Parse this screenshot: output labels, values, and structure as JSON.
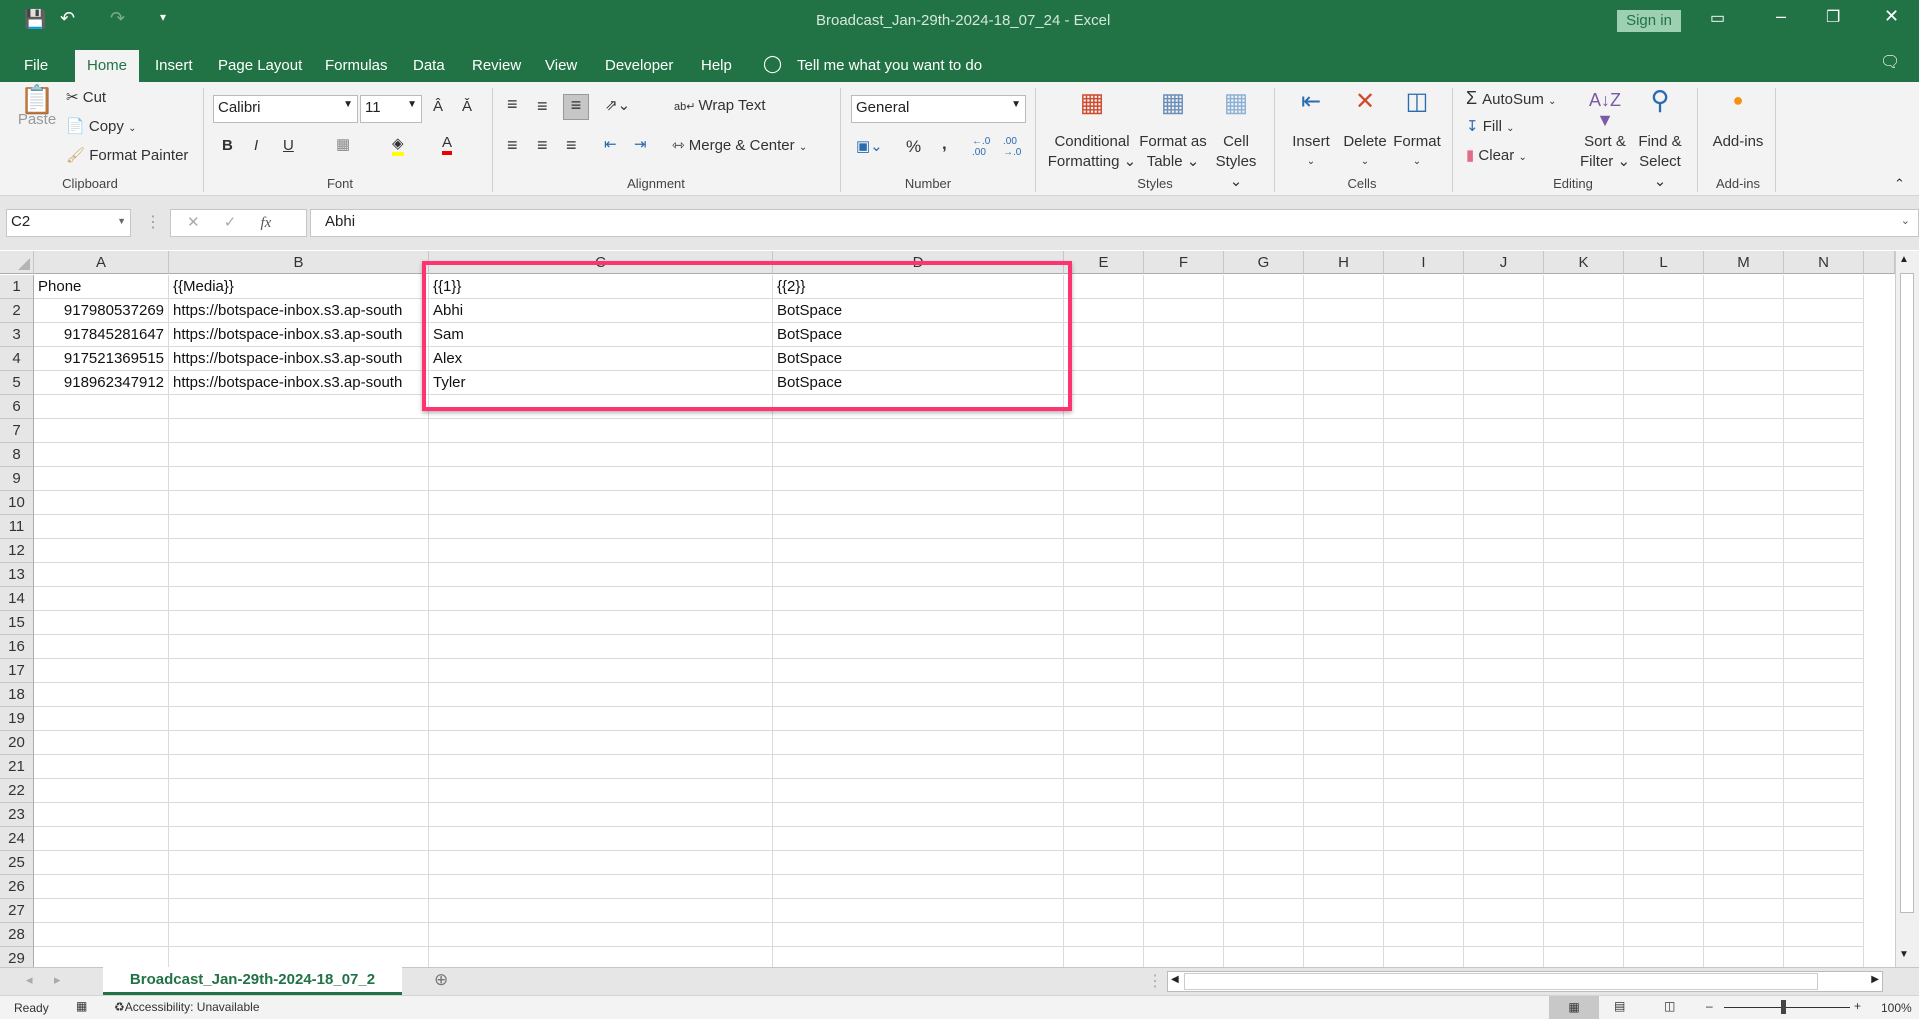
{
  "title": "Broadcast_Jan-29th-2024-18_07_24  -  Excel",
  "sign_in": "Sign in",
  "tabs": [
    "File",
    "Home",
    "Insert",
    "Page Layout",
    "Formulas",
    "Data",
    "Review",
    "View",
    "Developer",
    "Help"
  ],
  "tell_me": "Tell me what you want to do",
  "ribbon": {
    "clipboard": {
      "paste": "Paste",
      "cut": "Cut",
      "copy": "Copy",
      "format_painter": "Format Painter",
      "label": "Clipboard"
    },
    "font": {
      "name": "Calibri",
      "size": "11",
      "bold": "B",
      "italic": "I",
      "underline": "U",
      "label": "Font"
    },
    "alignment": {
      "wrap": "Wrap Text",
      "merge": "Merge & Center",
      "label": "Alignment"
    },
    "number": {
      "format": "General",
      "percent": "%",
      "comma": ",",
      "label": "Number"
    },
    "styles": {
      "conditional": [
        "Conditional",
        "Formatting"
      ],
      "format_table": [
        "Format as",
        "Table"
      ],
      "cell_styles": [
        "Cell",
        "Styles"
      ],
      "label": "Styles"
    },
    "cells": {
      "insert": "Insert",
      "delete": "Delete",
      "format": "Format",
      "label": "Cells"
    },
    "editing": {
      "autosum": "AutoSum",
      "fill": "Fill",
      "clear": "Clear",
      "sort": [
        "Sort &",
        "Filter"
      ],
      "find": [
        "Find &",
        "Select"
      ],
      "label": "Editing"
    },
    "addins": {
      "button": "Add-ins",
      "label": "Add-ins"
    }
  },
  "name_box": "C2",
  "formula": "Abhi",
  "fx": "fx",
  "columns": [
    "A",
    "B",
    "C",
    "D",
    "E",
    "F",
    "G",
    "H",
    "I",
    "J",
    "K",
    "L",
    "M",
    "N"
  ],
  "row_count": 29,
  "cells": [
    [
      "Phone",
      "{{Media}}",
      "{{1}}",
      "{{2}}"
    ],
    [
      "917980537269",
      "https://botspace-inbox.s3.ap-south",
      "Abhi",
      "BotSpace"
    ],
    [
      "917845281647",
      "https://botspace-inbox.s3.ap-south",
      "Sam",
      "BotSpace"
    ],
    [
      "917521369515",
      "https://botspace-inbox.s3.ap-south",
      "Alex",
      "BotSpace"
    ],
    [
      "918962347912",
      "https://botspace-inbox.s3.ap-south",
      "Tyler",
      "BotSpace"
    ]
  ],
  "sheet_tab": "Broadcast_Jan-29th-2024-18_07_2",
  "status": {
    "ready": "Ready",
    "accessibility": "Accessibility: Unavailable",
    "zoom": "100%"
  },
  "colors": {
    "brand": "#217346",
    "highlight": "#ff3370"
  }
}
